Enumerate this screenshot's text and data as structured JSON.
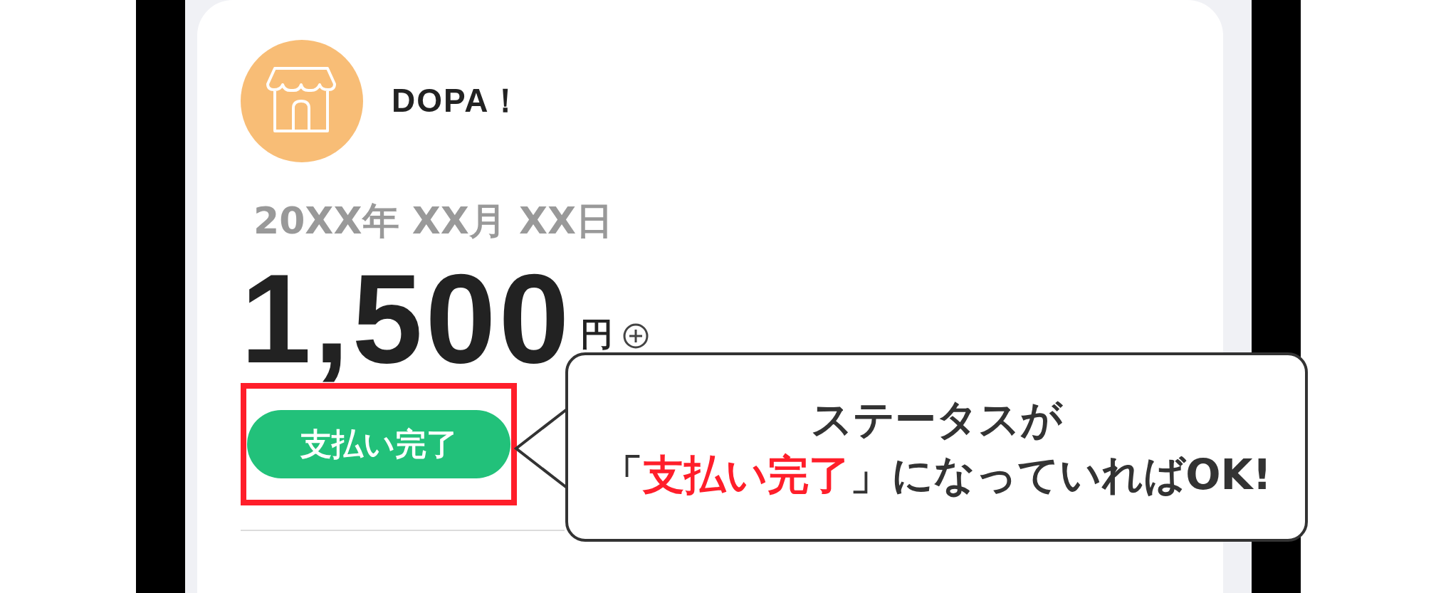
{
  "shop": {
    "name": "DOPA！"
  },
  "payment": {
    "date": "20XX年 XX月 XX日",
    "amount": "1,500",
    "currency": "円"
  },
  "status": {
    "label": "支払い完了",
    "highlighted": true
  },
  "callout": {
    "lines": [
      [
        {
          "text": "ステータスが",
          "highlight": false
        }
      ],
      [
        {
          "text": "「",
          "highlight": false
        },
        {
          "text": "支払い完了",
          "highlight": true
        },
        {
          "text": "」になっていればOK!",
          "highlight": false
        }
      ]
    ]
  }
}
